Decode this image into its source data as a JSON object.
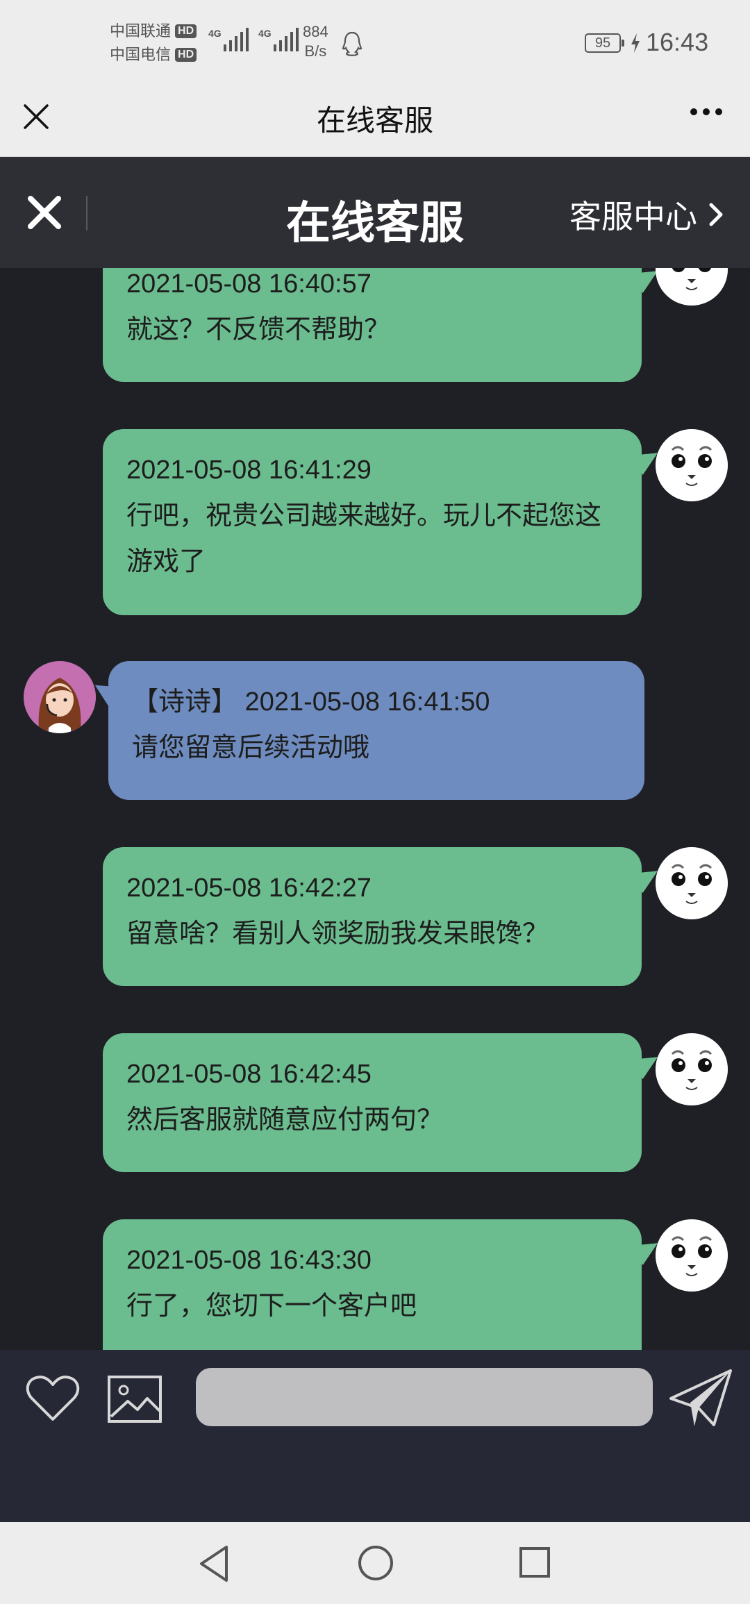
{
  "status_bar": {
    "carrier_1": "中国联通",
    "carrier_2": "中国电信",
    "hd_badge": "HD",
    "network_type": "4G",
    "speed_value": "884",
    "speed_unit": "B/s",
    "battery": "95",
    "time": "16:43"
  },
  "wechat_header": {
    "title": "在线客服"
  },
  "app_header": {
    "title": "在线客服",
    "center_link": "客服中心"
  },
  "messages": [
    {
      "sender": "user",
      "time": "2021-05-08 16:40:57",
      "text": "就这？不反馈不帮助？"
    },
    {
      "sender": "user",
      "time": "2021-05-08 16:41:29",
      "text": "行吧，祝贵公司越来越好。玩儿不起您这游戏了"
    },
    {
      "sender": "agent",
      "time": "【诗诗】 2021-05-08 16:41:50",
      "text": "请您留意后续活动哦"
    },
    {
      "sender": "user",
      "time": "2021-05-08 16:42:27",
      "text": "留意啥？看别人领奖励我发呆眼馋？"
    },
    {
      "sender": "user",
      "time": "2021-05-08 16:42:45",
      "text": "然后客服就随意应付两句？"
    },
    {
      "sender": "user",
      "time": "2021-05-08 16:43:30",
      "text": "行了，您切下一个客户吧"
    }
  ],
  "input_bar": {
    "input_value": "",
    "input_placeholder": ""
  },
  "colors": {
    "user_bubble": "#6bbd8f",
    "agent_bubble": "#6e8cbf",
    "chat_background": "#1f2026",
    "app_header": "#2e2f35"
  },
  "icons": [
    "close-icon",
    "more-icon",
    "chevron-right-icon",
    "heart-icon",
    "image-icon",
    "send-icon",
    "back-icon",
    "home-icon",
    "recent-apps-icon"
  ]
}
